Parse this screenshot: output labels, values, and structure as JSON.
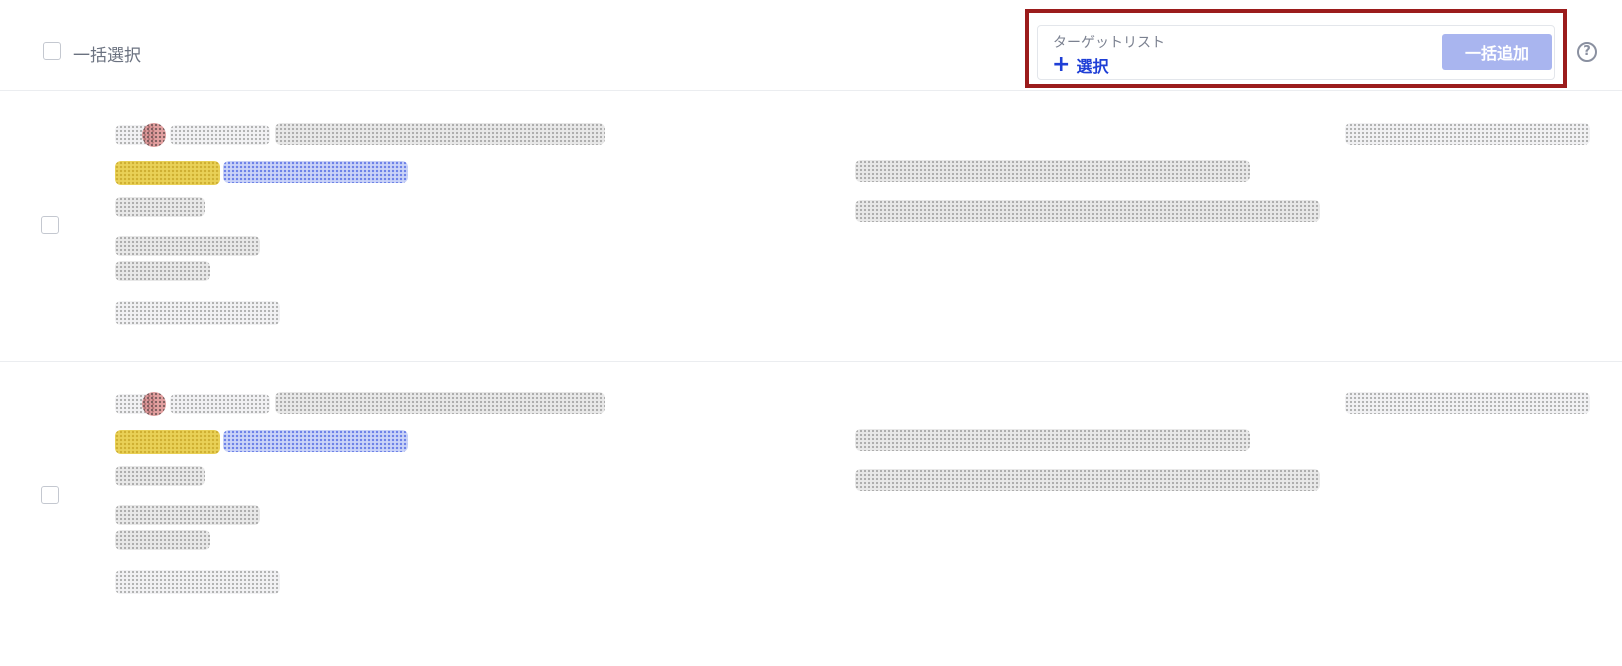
{
  "header": {
    "bulk_select_label": "一括選択",
    "target_list": {
      "title": "ターゲットリスト",
      "select_label": "選択",
      "plus_symbol": "+"
    },
    "bulk_add_label": "一括追加",
    "help_symbol": "?"
  },
  "colors": {
    "accent": "#1f3fd6",
    "button_disabled": "#a9b5ef",
    "highlight_border": "#9b1c1c"
  }
}
